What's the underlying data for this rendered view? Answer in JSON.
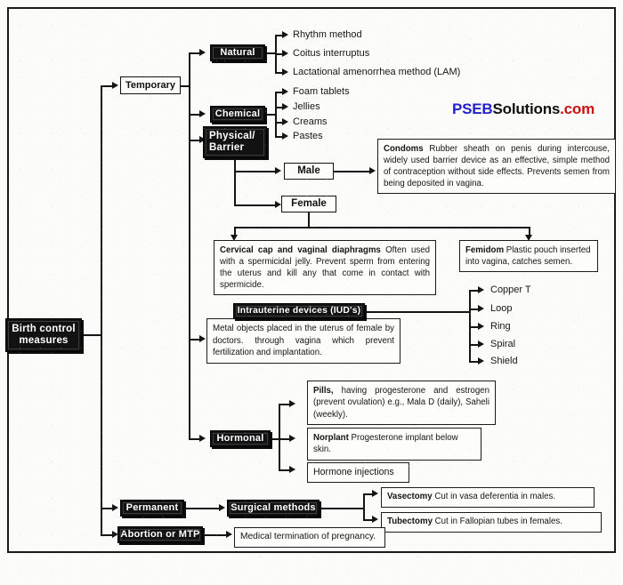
{
  "diagram": {
    "title": "Birth control measures",
    "type": "flowchart",
    "root": {
      "label": "Birth control\nmeasures"
    },
    "branches": [
      {
        "label": "Temporary"
      },
      {
        "label": "Permanent"
      },
      {
        "label": "Abortion or MTP"
      }
    ],
    "temporary_children": [
      {
        "label": "Natural"
      },
      {
        "label": "Chemical"
      },
      {
        "label": "Physical/\nBarrier"
      },
      {
        "label": "Intrauterine devices  (IUD's)"
      },
      {
        "label": "Hormonal"
      }
    ],
    "natural_methods": [
      "Rhythm method",
      "Coitus interruptus",
      "Lactational amenorrhea method  (LAM)"
    ],
    "chemical_methods": [
      "Foam tablets",
      "Jellies",
      "Creams",
      "Pastes"
    ],
    "barrier_types": [
      {
        "label": "Male"
      },
      {
        "label": "Female"
      }
    ],
    "condoms": {
      "term": "Condoms",
      "description": "Rubber sheath on penis during intercouse, widely used barrier device as an effective, simple method of contraception without side effects. Prevents semen from being deposited in vagina."
    },
    "cervical_cap": {
      "term": "Cervical cap and vaginal  diaphragms",
      "description": "Often used with a spermicidal jelly. Prevent sperm from entering the uterus and kill any that come in contact with spermicide."
    },
    "femidom": {
      "term": "Femidom",
      "description": "Plastic pouch inserted into vagina, catches semen."
    },
    "iud": {
      "label": "Intrauterine devices  (IUD's)",
      "description": "Metal objects placed in the uterus of female by doctors.  through  vagina  which  prevent fertilization and implantation.",
      "types": [
        "Copper T",
        "Loop",
        "Ring",
        "Spiral",
        "Shield"
      ]
    },
    "hormonal": {
      "label": "Hormonal",
      "items": [
        {
          "term": "Pills,",
          "description": "having progesterone and estrogen (prevent ovulation) e.g., Mala D (daily), Saheli (weekly)."
        },
        {
          "term": "Norplant",
          "description": "Progesterone implant below skin."
        },
        {
          "term": "Hormone injections",
          "description": ""
        }
      ]
    },
    "permanent": {
      "label": "Permanent",
      "method": "Surgical methods",
      "items": [
        {
          "term": "Vasectomy",
          "description": "Cut in vasa deferentia in males."
        },
        {
          "term": "Tubectomy",
          "description": "Cut in Fallopian tubes in females."
        }
      ]
    },
    "abortion": {
      "label": "Abortion or MTP",
      "detail": "Medical termination of pregnancy."
    }
  },
  "watermark": {
    "part1": "PSEB",
    "part2": "Solutions",
    "part3": ".com"
  },
  "colors": {
    "dark_box_bg": "#121212",
    "dark_box_text": "#ffffff",
    "line": "#151515",
    "paper": "#fbfbf9",
    "watermark_blue": "#2222cc",
    "watermark_black": "#101010",
    "watermark_red": "#cc1111"
  }
}
